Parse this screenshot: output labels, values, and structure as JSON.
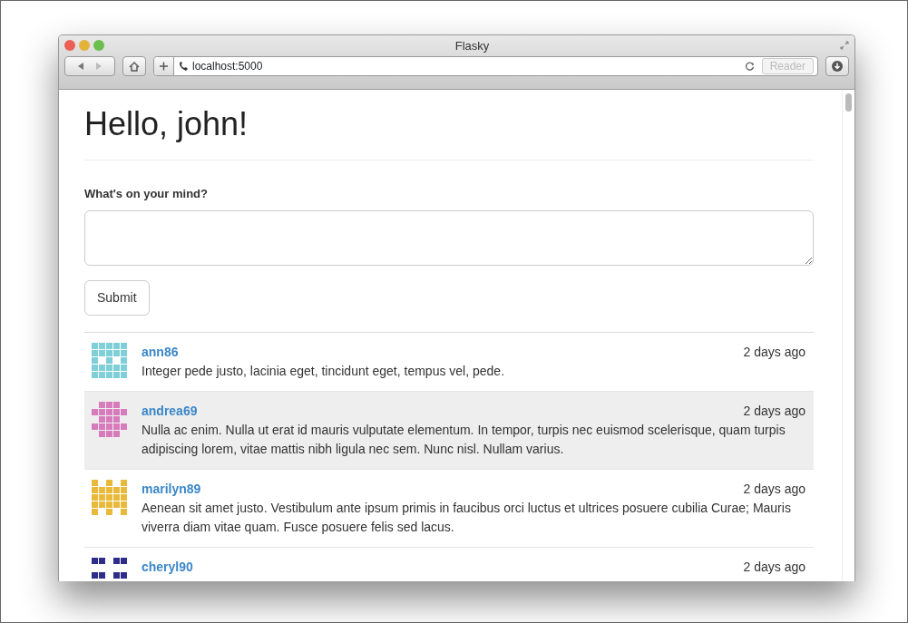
{
  "window": {
    "title": "Flasky"
  },
  "toolbar": {
    "address": "localhost:5000",
    "reader_button": "Reader",
    "reader_disabled": true
  },
  "page": {
    "heading": "Hello, john!",
    "form": {
      "label": "What's on your mind?",
      "submit": "Submit"
    },
    "posts": [
      {
        "author": "ann86",
        "date": "2 days ago",
        "body": "Integer pede justo, lacinia eget, tincidunt eget, tempus vel, pede.",
        "color": "#7fcfd8",
        "highlighted": false
      },
      {
        "author": "andrea69",
        "date": "2 days ago",
        "body": "Nulla ac enim. Nulla ut erat id mauris vulputate elementum. In tempor, turpis nec euismod scelerisque, quam turpis adipiscing lorem, vitae mattis nibh ligula nec sem. Nunc nisl. Nullam varius.",
        "color": "#d77bbd",
        "highlighted": true
      },
      {
        "author": "marilyn89",
        "date": "2 days ago",
        "body": "Aenean sit amet justo. Vestibulum ante ipsum primis in faucibus orci luctus et ultrices posuere cubilia Curae; Mauris viverra diam vitae quam. Fusce posuere felis sed lacus.",
        "color": "#e8b93a",
        "highlighted": false
      },
      {
        "author": "cheryl90",
        "date": "2 days ago",
        "color": "#2e2d8a",
        "highlighted": false
      }
    ]
  }
}
